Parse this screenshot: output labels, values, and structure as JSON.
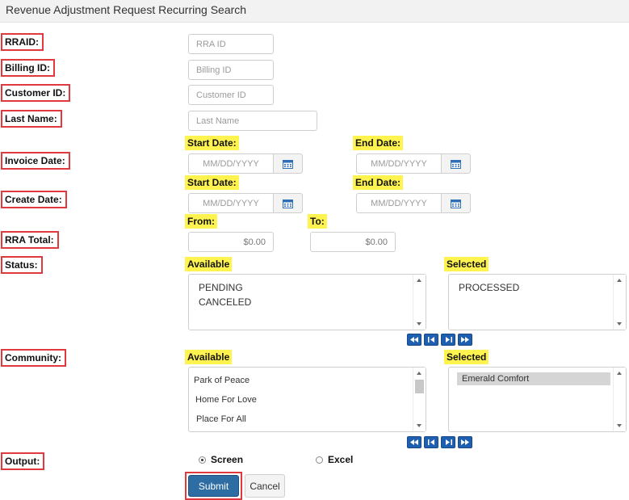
{
  "title": "Revenue Adjustment Request Recurring Search",
  "labels": {
    "rraid": "RRAID:",
    "billing_id": "Billing ID:",
    "customer_id": "Customer ID:",
    "last_name": "Last Name:",
    "invoice_date": "Invoice Date:",
    "create_date": "Create Date:",
    "rra_total": "RRA Total:",
    "status": "Status:",
    "community": "Community:",
    "output": "Output:"
  },
  "fields": {
    "rraid_placeholder": "RRA ID",
    "billing_placeholder": "Billing ID",
    "customer_placeholder": "Customer ID",
    "lastname_placeholder": "Last Name",
    "date_placeholder": "MM/DD/YYYY",
    "total_from_value": "$0.00",
    "total_to_value": "$0.00"
  },
  "date_labels": {
    "start": "Start Date:",
    "end": "End Date:",
    "from": "From:",
    "to": "To:"
  },
  "status": {
    "available_label": "Available",
    "selected_label": "Selected",
    "available": [
      "PENDING",
      "CANCELED"
    ],
    "selected": [
      "PROCESSED"
    ]
  },
  "community": {
    "available_label": "Available",
    "selected_label": "Selected",
    "available": [
      "Park of Peace",
      "Home For Love",
      "Place For All"
    ],
    "selected": [
      "Emerald Comfort"
    ]
  },
  "output": {
    "options": [
      "Screen",
      "Excel"
    ],
    "selected": "Screen"
  },
  "buttons": {
    "submit": "Submit",
    "cancel": "Cancel"
  },
  "colors": {
    "accent_blue": "#2e6da4",
    "highlight": "#fff44f",
    "outline_red": "#e0393e"
  },
  "icons": {
    "calendar": "calendar-icon",
    "move_all_left": "double-arrow-left-icon",
    "move_left": "arrow-left-icon",
    "move_right": "arrow-right-icon",
    "move_all_right": "double-arrow-right-icon"
  }
}
